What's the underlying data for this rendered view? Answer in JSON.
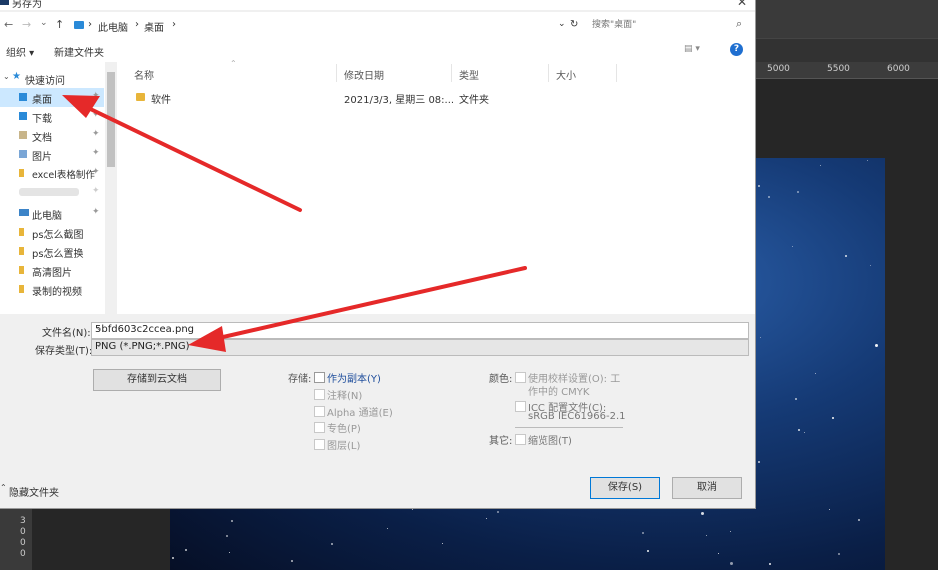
{
  "dialog": {
    "title": "另存为",
    "close_glyph": "✕"
  },
  "address_bar": {
    "back": "←",
    "forward": "→",
    "recent": "⌄",
    "up": "↑",
    "crumb_sep": "›",
    "crumbs": [
      "此电脑",
      "桌面"
    ],
    "dropdown_glyph": "⌄",
    "refresh_glyph": "↻",
    "search_placeholder": "搜索\"桌面\"",
    "search_icon": "⌕"
  },
  "toolbar": {
    "organize": "组织 ▾",
    "new_folder": "新建文件夹",
    "view_glyph": "▤ ▾",
    "help": "?"
  },
  "nav_pane": {
    "quick_access": "快速访问",
    "items": [
      {
        "label": "桌面",
        "icon": "desktop-folder-icon",
        "pinned": true,
        "selected": true
      },
      {
        "label": "下载",
        "icon": "download-folder-icon",
        "pinned": true
      },
      {
        "label": "文档",
        "icon": "documents-folder-icon",
        "pinned": true
      },
      {
        "label": "图片",
        "icon": "pictures-folder-icon",
        "pinned": true
      },
      {
        "label": "excel表格制作",
        "icon": "folder-icon",
        "pinned": true
      },
      {
        "label": "",
        "icon": "folder-icon",
        "pinned": true
      },
      {
        "label": "此电脑",
        "icon": "computer-icon",
        "pinned": true
      },
      {
        "label": "ps怎么截图",
        "icon": "folder-icon"
      },
      {
        "label": "ps怎么置换",
        "icon": "folder-icon"
      },
      {
        "label": "高清图片",
        "icon": "folder-icon"
      },
      {
        "label": "录制的视频",
        "icon": "folder-icon"
      }
    ],
    "pin_glyph": "✦"
  },
  "file_list": {
    "columns": [
      "名称",
      "修改日期",
      "类型",
      "大小"
    ],
    "rows": [
      {
        "name": "软件",
        "modified": "2021/3/3, 星期三 08:...",
        "type": "文件夹",
        "size": ""
      }
    ]
  },
  "save_fields": {
    "filename_label": "文件名(N):",
    "filename_value": "5bfd603c2ccea.png",
    "type_label": "保存类型(T):",
    "type_value": "PNG (*.PNG;*.PNG)",
    "dropdown_glyph": "⌄"
  },
  "options": {
    "cloud_button": "存储到云文档",
    "save_label": "存储:",
    "save_options": [
      {
        "label": "作为副本(Y)",
        "enabled": true
      },
      {
        "label": "注释(N)",
        "enabled": false
      },
      {
        "label": "Alpha 通道(E)",
        "enabled": false
      },
      {
        "label": "专色(P)",
        "enabled": false
      },
      {
        "label": "图层(L)",
        "enabled": false
      }
    ],
    "color_label": "颜色:",
    "proof_setup_line1": "使用校样设置(O): 工",
    "proof_setup_line2": "作中的 CMYK",
    "icc_line1": "ICC 配置文件(C):",
    "icc_line2": "sRGB IEC61966-2.1",
    "other_label": "其它:",
    "thumbnail": "缩览图(T)"
  },
  "footer": {
    "hide_folders": "隐藏文件夹",
    "save_button": "保存(S)",
    "cancel_button": "取消"
  },
  "photoshop": {
    "ruler_ticks": [
      "5000",
      "5500",
      "6000"
    ],
    "left_values": [
      "3",
      "0",
      "0",
      "0"
    ]
  },
  "colors": {
    "arrow": "#e52929",
    "selection": "#cce8ff",
    "link_blue": "#1f4e9c",
    "accent": "#0078d7"
  }
}
